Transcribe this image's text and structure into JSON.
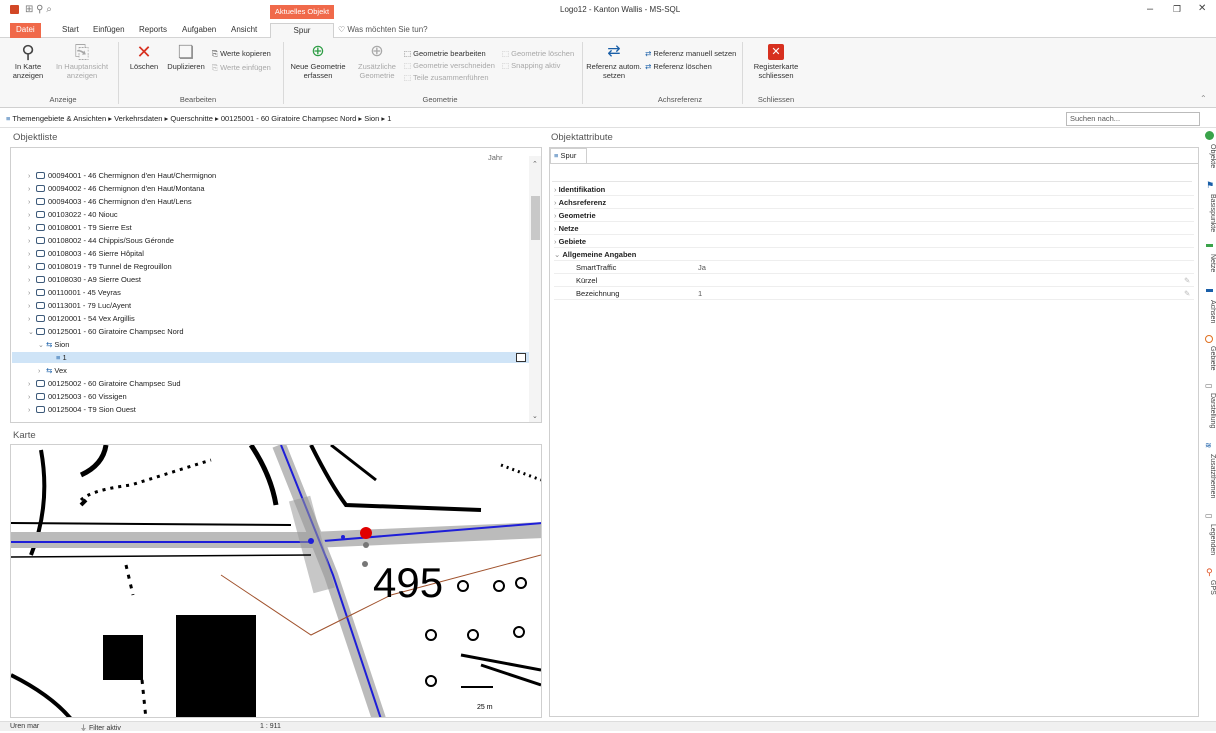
{
  "window": {
    "title": "Logo12 - Kanton Wallis - MS-SQL",
    "context_tab": "Aktuelles Objekt"
  },
  "tabs": [
    "Datei",
    "Start",
    "Einfügen",
    "Reports",
    "Aufgaben",
    "Ansicht",
    "Spur"
  ],
  "tell_me": "Was möchten Sie tun?",
  "ribbon": {
    "in_karte": "In Karte anzeigen",
    "in_hauptansicht": "In Hauptansicht anzeigen",
    "loeschen": "Löschen",
    "duplizieren": "Duplizieren",
    "werte_kopieren": "Werte kopieren",
    "werte_einfuegen": "Werte einfügen",
    "neue_geometrie": "Neue Geometrie erfassen",
    "zusaetzliche_geometrie": "Zusätzliche Geometrie",
    "geometrie_bearbeiten": "Geometrie bearbeiten",
    "geometrie_verschneiden": "Geometrie verschneiden",
    "teile_zusammenfuehren": "Teile zusammenführen",
    "geometrie_loeschen": "Geometrie löschen",
    "snapping_aktiv": "Snapping aktiv",
    "referenz_autom": "Referenz autom. setzen",
    "referenz_manuell": "Referenz manuell setzen",
    "referenz_loeschen": "Referenz löschen",
    "registerkarte_schliessen": "Registerkarte schliessen",
    "groups": {
      "anzeige": "Anzeige",
      "bearbeiten": "Bearbeiten",
      "geometrie": "Geometrie",
      "achsreferenz": "Achsreferenz",
      "schliessen": "Schliessen"
    }
  },
  "breadcrumb": "Themengebiete & Ansichten  ▸  Verkehrsdaten  ▸  Querschnitte  ▸  00125001 - 60 Giratoire Champsec Nord  ▸  Sion  ▸  1",
  "search_placeholder": "Suchen nach...",
  "objektliste": {
    "title": "Objektliste",
    "col_jahr": "Jahr",
    "rows": [
      "00094001 - 46 Chermignon d'en Haut/Chermignon",
      "00094002 - 46 Chermignon d'en Haut/Montana",
      "00094003 - 46 Chermignon d'en Haut/Lens",
      "00103022 - 40 Niouc",
      "00108001 - T9 Sierre Est",
      "00108002 - 44 Chippis/Sous Géronde",
      "00108003 - 46 Sierre Hôpital",
      "00108019 - T9 Tunnel de Regrouillon",
      "00108030 - A9 Sierre Ouest",
      "00110001 - 45 Veyras",
      "00113001 - 79 Luc/Ayent",
      "00120001 - 54 Vex Argillis",
      "00125001 - 60 Giratoire Champsec Nord"
    ],
    "child_sion": "Sion",
    "child_1": "1",
    "child_vex": "Vex",
    "rows_after": [
      "00125002 - 60 Giratoire Champsec Sud",
      "00125003 - 60 Vissigen",
      "00125004 - T9 Sion Ouest"
    ]
  },
  "karte": {
    "title": "Karte",
    "map_number": "495",
    "scale_label": "25 m"
  },
  "objektattribute": {
    "title": "Objektattribute",
    "tab": "Spur",
    "sections": [
      "Identifikation",
      "Achsreferenz",
      "Geometrie",
      "Netze",
      "Gebiete",
      "Allgemeine Angaben"
    ],
    "fields": [
      {
        "label": "SmartTraffic",
        "value": "Ja"
      },
      {
        "label": "Kürzel",
        "value": ""
      },
      {
        "label": "Bezeichnung",
        "value": "1"
      }
    ]
  },
  "sidebar": [
    "Objekte",
    "Basispunkte",
    "Netze",
    "Achsen",
    "Gebiete",
    "Darstellung",
    "Zusatzthemen",
    "Legenden",
    "GPS"
  ],
  "statusbar": {
    "user": "Uren mar",
    "filter": "Filter aktiv",
    "scale": "1 : 911"
  },
  "colors": {
    "accent": "#d24726",
    "context_tab": "#f0694a",
    "check": "#3aa34a"
  }
}
